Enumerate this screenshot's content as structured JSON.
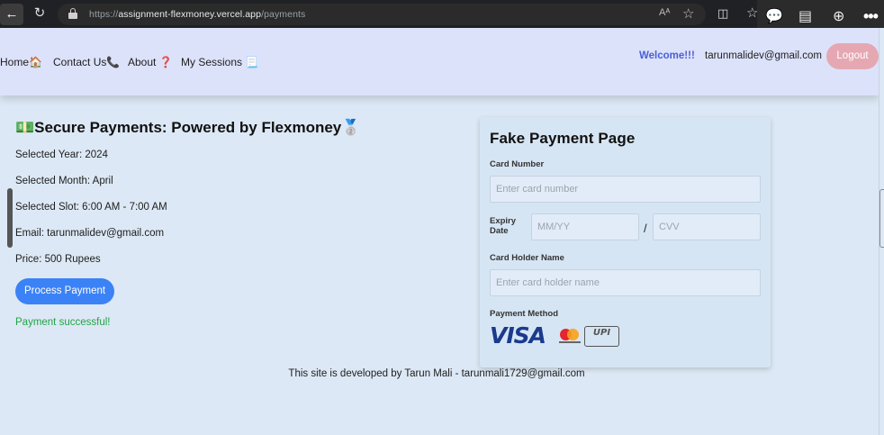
{
  "browser": {
    "url_scheme": "https://",
    "url_host": "assignment-flexmoney.vercel.app",
    "url_path": "/payments",
    "reader_label": "Aᴬ"
  },
  "navbar": {
    "links": [
      {
        "label": "Home",
        "icon": "🏠"
      },
      {
        "label": "Contact Us",
        "icon": "📞"
      },
      {
        "label": "About",
        "icon": "❓"
      },
      {
        "label": "My Sessions",
        "icon": "📃"
      }
    ],
    "welcome": "Welcome!!!",
    "user_email": "tarunmalidev@gmail.com",
    "logout_label": "Logout"
  },
  "payment_info": {
    "title": "Secure Payments: Powered by Flexmoney",
    "title_icon_left": "💵",
    "title_icon_right": "🥈",
    "lines": [
      "Selected Year: 2024",
      "Selected Month: April",
      "Selected Slot: 6:00 AM - 7:00 AM",
      "Email: tarunmalidev@gmail.com",
      "Price: 500 Rupees"
    ],
    "process_button": "Process Payment",
    "status": "Payment successful!"
  },
  "card_form": {
    "title": "Fake Payment Page",
    "card_number_label": "Card Number",
    "card_number_placeholder": "Enter card number",
    "expiry_label_1": "Expiry",
    "expiry_label_2": "Date",
    "expiry_placeholder": "MM/YY",
    "separator": "/",
    "cvv_placeholder": "CVV",
    "holder_label": "Card Holder Name",
    "holder_placeholder": "Enter card holder name",
    "method_label": "Payment Method",
    "methods": [
      "VISA",
      "Mastercard",
      "UPI"
    ]
  },
  "footer": {
    "text": "This site is developed by Tarun Mali - tarunmali1729@gmail.com"
  },
  "colors": {
    "page_bg": "#dce8f5",
    "navbar_bg": "#dde2fb",
    "primary_button": "#3b82f6",
    "logout_button": "#e5a8b2",
    "success_text": "#22a447",
    "welcome_text": "#4a5fd6"
  }
}
